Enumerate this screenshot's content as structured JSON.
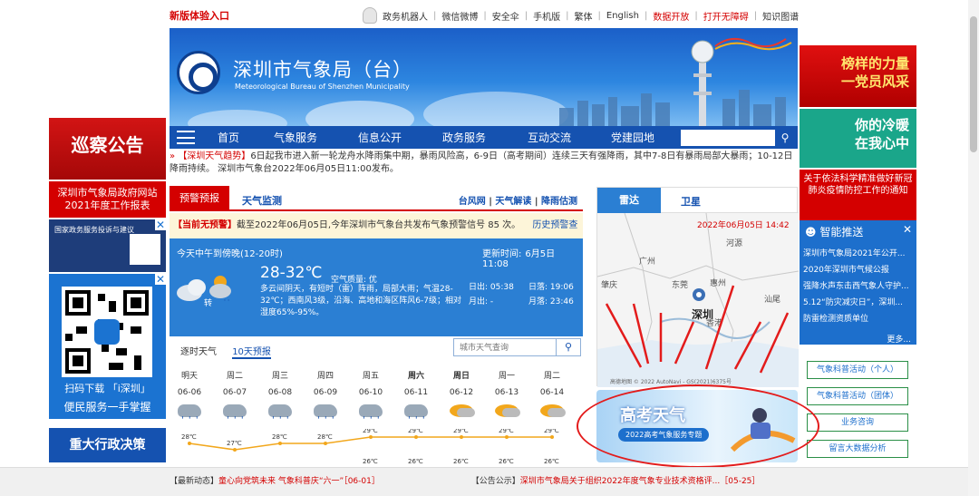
{
  "topbar": {
    "new_version": "新版体验入口",
    "links": [
      "政务机器人",
      "微信微博",
      "安全伞",
      "手机版",
      "繁体",
      "English",
      "数据开放",
      "打开无障碍",
      "知识图谱"
    ]
  },
  "banner": {
    "title": "深圳市气象局（台）",
    "subtitle": "Meteorological Bureau of Shenzhen Municipality"
  },
  "nav": {
    "items": [
      "首页",
      "气象服务",
      "信息公开",
      "政务服务",
      "互动交流",
      "党建园地"
    ],
    "search_placeholder": ""
  },
  "ticker": {
    "tag": "【深圳天气趋势】",
    "text": "6日起我市进入新一轮龙舟水降雨集中期，暴雨风险高，6-9日（高考期间）连续三天有强降雨，其中7-8日有暴雨局部大暴雨；10-12日降雨持续。 深圳市气象台2022年06月05日11:00发布。"
  },
  "left_ads": {
    "inspect": "巡察公告",
    "report": "深圳市气象局政府网站2021年度工作报表",
    "gov": "国家政务服务投诉与建议",
    "qr_caption": "扫码下载 「i深圳」",
    "qr_sub": "便民服务一手掌握",
    "decision": "重大行政决策"
  },
  "right_ads": {
    "party_line1": "榜样的力量",
    "party_line2": "一党员风采",
    "warm_line1": "你的冷暖",
    "warm_line2": "在我心中",
    "notice": "关于依法科学精准做好新冠肺炎疫情防控工作的通知"
  },
  "push": {
    "title": "智能推送",
    "items": [
      "深圳市气象局2021年公开...",
      "2020年深圳市气候公报",
      "强降水声东击西气象人守护...",
      "5.12“防灾减灾日”，深圳...",
      "防雷检测资质单位"
    ],
    "more": "更多..."
  },
  "side_buttons": [
    "气象科普活动（个人）",
    "气象科普活动（团体）",
    "业务咨询",
    "留言大数据分析"
  ],
  "warning": {
    "tab_warn": "预警预报",
    "tab_monitor": "天气监测",
    "links": [
      "台风网",
      "天气解读",
      "降雨估测"
    ],
    "banner_tag": "【当前无预警】",
    "banner_text": "截至2022年06月05日,今年深圳市气象台共发布气象预警信号 85 次。",
    "banner_link": "历史预警查询"
  },
  "now": {
    "period": "今天中午到傍晚(12-20时)",
    "update_label": "更新时间:",
    "update_time": "6月5日 11:08",
    "temp": "28-32℃",
    "aqi_label": "空气质量:",
    "aqi_value": "优",
    "desc": "多云间阴天，有短时（雷）阵雨，局部大雨；气温28-32℃；西南风3级，沿海、高地和海区阵风6-7级；相对湿度65%-95%。",
    "turn": "转",
    "sunrise_label": "日出:",
    "sunrise": "05:38",
    "sunset_label": "日落:",
    "sunset": "19:06",
    "moonrise_label": "月出:",
    "moonrise": "-",
    "moonset_label": "月落:",
    "moonset": "23:46"
  },
  "forecast": {
    "tab1": "逐时天气",
    "tab2": "10天预报",
    "search_placeholder": "城市天气查询",
    "days": [
      "明天",
      "周二",
      "周三",
      "周四",
      "周五",
      "周六",
      "周日",
      "周一",
      "周二"
    ],
    "dates": [
      "06-06",
      "06-07",
      "06-08",
      "06-09",
      "06-10",
      "06-11",
      "06-12",
      "06-13",
      "06-14"
    ],
    "highs": [
      "28℃",
      "27℃",
      "28℃",
      "28℃",
      "29℃",
      "29℃",
      "29℃",
      "29℃",
      "29℃"
    ],
    "icons": [
      "rain",
      "rain",
      "rain",
      "rain",
      "rain",
      "rain",
      "sun-cloud",
      "sun-cloud",
      "sun-cloud"
    ],
    "lows": [
      "",
      "",
      "",
      "",
      "26℃",
      "26℃",
      "26℃",
      "26℃",
      "26℃"
    ]
  },
  "radar": {
    "tab_radar": "雷达",
    "tab_sat": "卫星",
    "timestamp": "2022年06月05日 14:42",
    "cities": [
      "河源",
      "广州",
      "东莞",
      "惠州",
      "深圳",
      "汕尾",
      "肇庆",
      "香港"
    ],
    "copyright": "高德地图 © 2022 AutoNavi - GS(2021)6375号"
  },
  "gaokao": {
    "title": "高考天气",
    "subtitle": "2022高考气象服务专题"
  },
  "bottom": {
    "news_tag": "【最新动态】",
    "news_text": "童心向党筑未来 气象科普庆“六一”［06-01］",
    "notice_tag": "【公告公示】",
    "notice_text": "深圳市气象局关于组织2022年度气象专业技术资格评...［05-25］"
  },
  "colors": {
    "brand_blue": "#1552b0",
    "alert_red": "#d40000",
    "panel_blue": "#2b7fd3",
    "annotation_red": "#e31b1b"
  }
}
